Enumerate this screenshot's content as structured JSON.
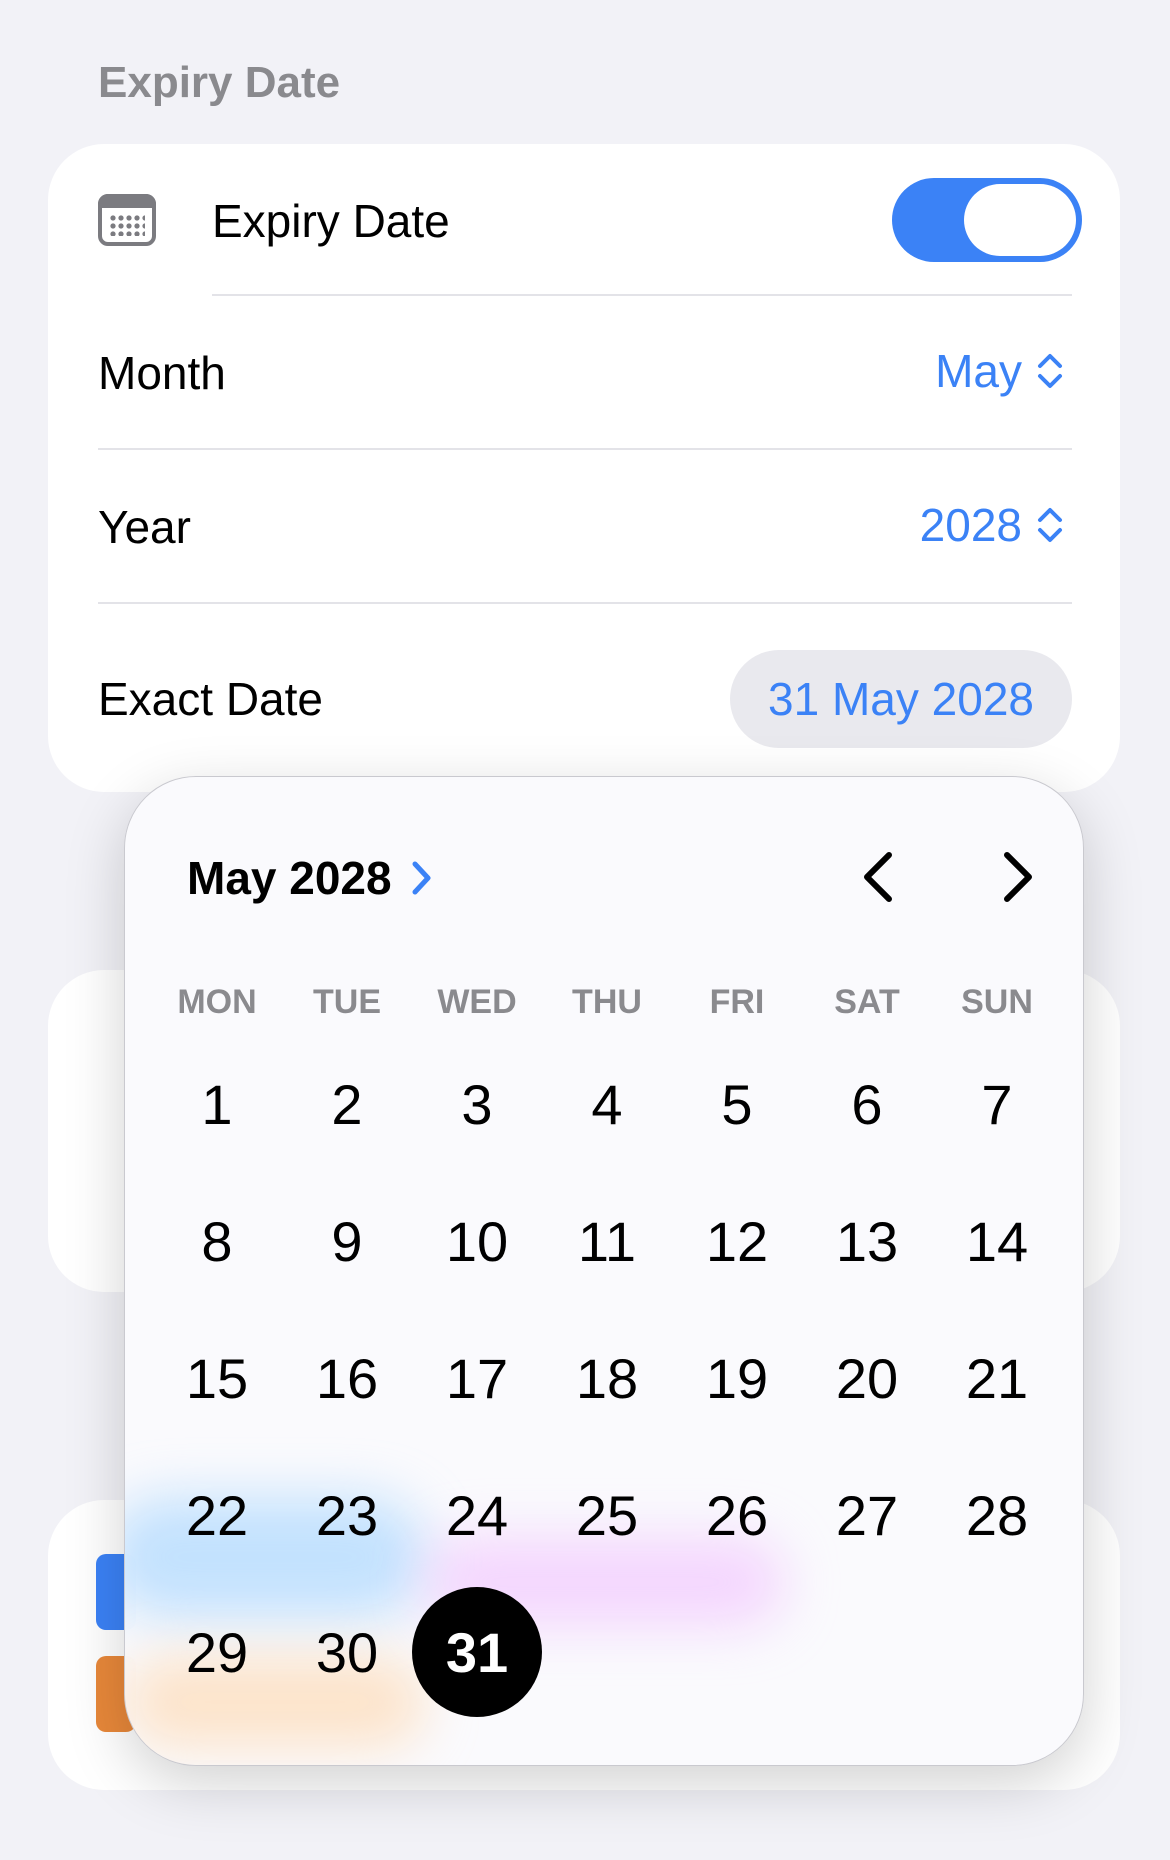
{
  "section": {
    "header": "Expiry Date"
  },
  "expiry": {
    "toggle_label": "Expiry Date",
    "toggle_on": true,
    "month_label": "Month",
    "month_value": "May",
    "year_label": "Year",
    "year_value": "2028",
    "exact_label": "Exact Date",
    "exact_value": "31 May 2028"
  },
  "calendar": {
    "title": "May 2028",
    "weekdays": [
      "MON",
      "TUE",
      "WED",
      "THU",
      "FRI",
      "SAT",
      "SUN"
    ],
    "weeks": [
      [
        "1",
        "2",
        "3",
        "4",
        "5",
        "6",
        "7"
      ],
      [
        "8",
        "9",
        "10",
        "11",
        "12",
        "13",
        "14"
      ],
      [
        "15",
        "16",
        "17",
        "18",
        "19",
        "20",
        "21"
      ],
      [
        "22",
        "23",
        "24",
        "25",
        "26",
        "27",
        "28"
      ],
      [
        "29",
        "30",
        "31"
      ]
    ],
    "selected_day": "31"
  },
  "colors": {
    "accent": "#3b82f6",
    "selected_bg": "#000000",
    "secondary_text": "#8a8a8e"
  }
}
